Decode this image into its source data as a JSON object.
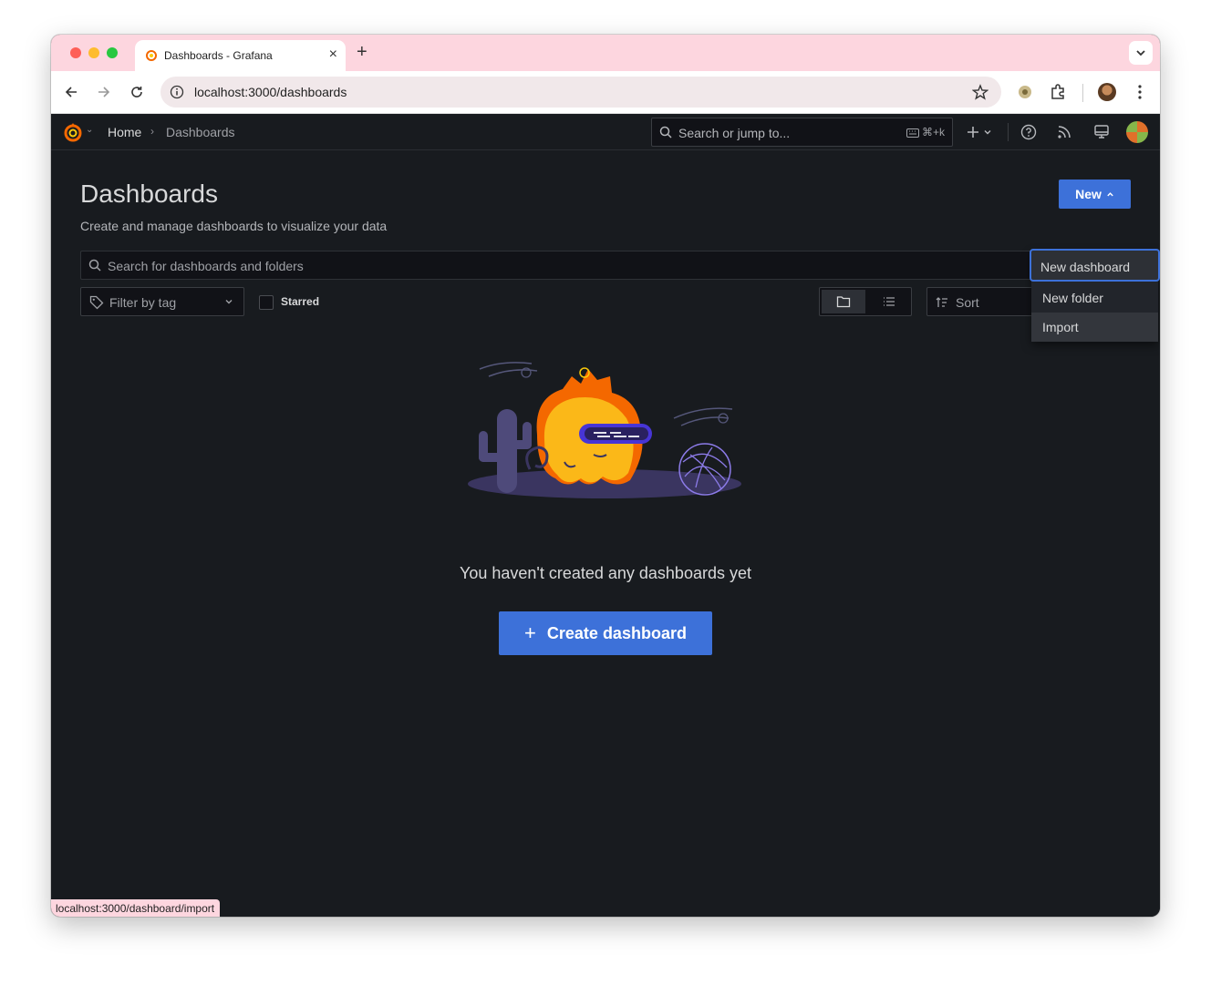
{
  "browser": {
    "tab_title": "Dashboards - Grafana",
    "tab_close": "×",
    "new_tab": "+",
    "url": "localhost:3000/dashboards",
    "status_url": "localhost:3000/dashboard/import"
  },
  "grafana": {
    "breadcrumb": {
      "home": "Home",
      "separator": "›",
      "current": "Dashboards"
    },
    "search": {
      "placeholder": "Search or jump to...",
      "shortcut": "⌘+k"
    },
    "page": {
      "title": "Dashboards",
      "subtitle": "Create and manage dashboards to visualize your data",
      "new_button": "New"
    },
    "new_menu": {
      "items": [
        "New dashboard",
        "New folder",
        "Import"
      ]
    },
    "browse": {
      "search_placeholder": "Search for dashboards and folders",
      "filter_tag": "Filter by tag",
      "starred": "Starred",
      "sort": "Sort"
    },
    "empty": {
      "message": "You haven't created any dashboards yet",
      "create_button": "Create dashboard",
      "create_icon": "+"
    }
  },
  "colors": {
    "primary": "#3d71d9",
    "background": "#181b1f",
    "tabstrip": "#fdd6df"
  }
}
